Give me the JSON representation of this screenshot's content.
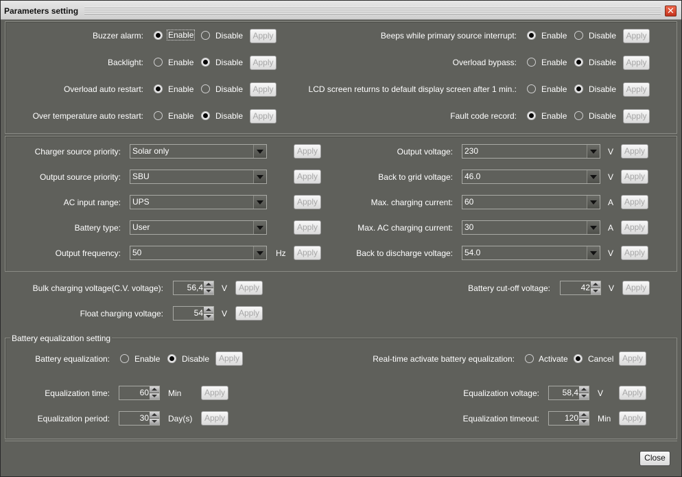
{
  "window": {
    "title": "Parameters setting",
    "close_label": "Close"
  },
  "common": {
    "enable": "Enable",
    "disable": "Disable",
    "apply": "Apply",
    "activate": "Activate",
    "cancel": "Cancel"
  },
  "toggles_left": [
    {
      "label": "Buzzer alarm:",
      "selected": "Enable"
    },
    {
      "label": "Backlight:",
      "selected": "Disable"
    },
    {
      "label": "Overload auto restart:",
      "selected": "Enable"
    },
    {
      "label": "Over temperature auto restart:",
      "selected": "Disable"
    }
  ],
  "toggles_right": [
    {
      "label": "Beeps while primary source interrupt:",
      "selected": "Enable"
    },
    {
      "label": "Overload bypass:",
      "selected": "Disable"
    },
    {
      "label": "LCD screen returns to default display screen after 1 min.:",
      "selected": "Disable"
    },
    {
      "label": "Fault code record:",
      "selected": "Enable"
    }
  ],
  "combos_left": [
    {
      "label": "Charger source priority:",
      "value": "Solar only",
      "unit": ""
    },
    {
      "label": "Output source priority:",
      "value": "SBU",
      "unit": ""
    },
    {
      "label": "AC input range:",
      "value": "UPS",
      "unit": ""
    },
    {
      "label": "Battery type:",
      "value": "User",
      "unit": ""
    },
    {
      "label": "Output frequency:",
      "value": "50",
      "unit": "Hz"
    }
  ],
  "combos_right": [
    {
      "label": "Output voltage:",
      "value": "230",
      "unit": "V"
    },
    {
      "label": "Back to grid voltage:",
      "value": "46.0",
      "unit": "V"
    },
    {
      "label": "Max. charging current:",
      "value": "60",
      "unit": "A"
    },
    {
      "label": "Max. AC charging current:",
      "value": "30",
      "unit": "A"
    },
    {
      "label": "Back to discharge voltage:",
      "value": "54.0",
      "unit": "V"
    }
  ],
  "spinners": {
    "bulk": {
      "label": "Bulk charging voltage(C.V. voltage):",
      "value": "56,4",
      "unit": "V"
    },
    "float": {
      "label": "Float charging voltage:",
      "value": "54",
      "unit": "V"
    },
    "cutoff": {
      "label": "Battery cut-off voltage:",
      "value": "42",
      "unit": "V"
    }
  },
  "equalization": {
    "group_title": "Battery equalization setting",
    "eq_label": "Battery equalization:",
    "eq_selected": "Disable",
    "realtime_label": "Real-time activate battery equalization:",
    "realtime_selected": "Cancel",
    "time": {
      "label": "Equalization time:",
      "value": "60",
      "unit": "Min"
    },
    "period": {
      "label": "Equalization period:",
      "value": "30",
      "unit": "Day(s)"
    },
    "voltage": {
      "label": "Equalization voltage:",
      "value": "58,4",
      "unit": "V"
    },
    "timeout": {
      "label": "Equalization timeout:",
      "value": "120",
      "unit": "Min"
    }
  }
}
